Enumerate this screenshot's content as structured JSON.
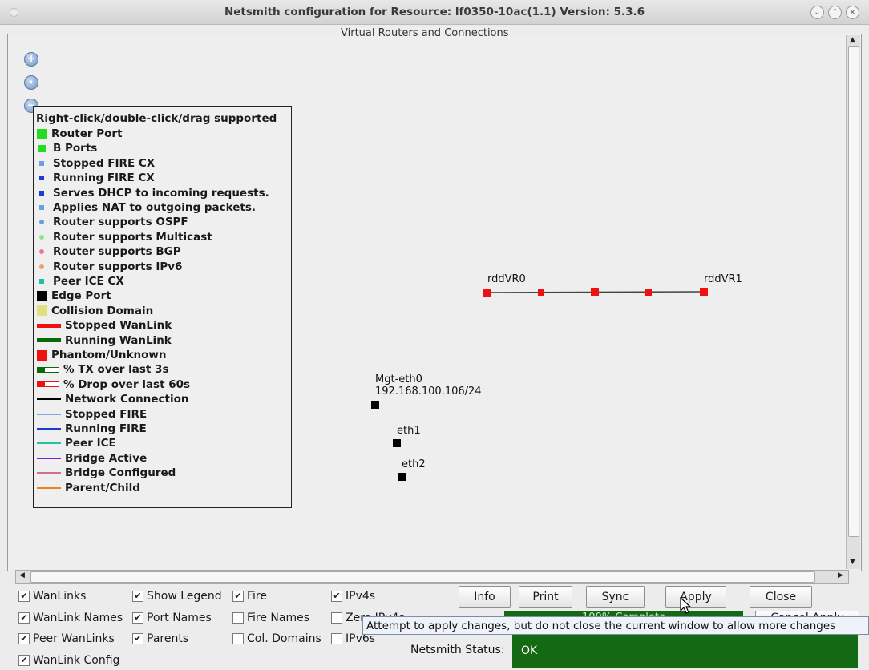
{
  "window": {
    "title": "Netsmith configuration for Resource:  lf0350-10ac(1.1)  Version: 5.3.6",
    "buttons": {
      "minimize": "⌄",
      "maximize": "⌃",
      "close": "×"
    }
  },
  "panel": {
    "title": "Virtual Routers and Connections",
    "zoom_icons": [
      "zoom-in-icon",
      "zoom-reset-icon",
      "zoom-out-icon"
    ]
  },
  "legend": {
    "header": "Right-click/double-click/drag supported",
    "items": [
      {
        "label": "Router Port",
        "kind": "square",
        "color": "#22dd22"
      },
      {
        "label": "B Ports",
        "kind": "square-sm",
        "color": "#22dd22"
      },
      {
        "label": "Stopped FIRE CX",
        "kind": "square-xs",
        "color": "#6d9ce8"
      },
      {
        "label": "Running FIRE CX",
        "kind": "square-xs",
        "color": "#1a3fd0"
      },
      {
        "label": "Serves DHCP to incoming requests.",
        "kind": "square-xs",
        "color": "#1a3fd0"
      },
      {
        "label": "Applies NAT to outgoing packets.",
        "kind": "square-xs",
        "color": "#6d9ce8"
      },
      {
        "label": "Router supports OSPF",
        "kind": "dot",
        "color": "#6d9ce8"
      },
      {
        "label": "Router supports Multicast",
        "kind": "dot",
        "color": "#88e888"
      },
      {
        "label": "Router supports BGP",
        "kind": "dot",
        "color": "#f07090"
      },
      {
        "label": "Router supports IPv6",
        "kind": "dot",
        "color": "#f59a60"
      },
      {
        "label": "Peer ICE CX",
        "kind": "square-xs",
        "color": "#1fbfa0"
      },
      {
        "label": "Edge Port",
        "kind": "square",
        "color": "#000000"
      },
      {
        "label": "Collision Domain",
        "kind": "square",
        "color": "#e0e080"
      },
      {
        "label": "Stopped WanLink",
        "kind": "bar-thick",
        "color": "#ee1111"
      },
      {
        "label": "Running WanLink",
        "kind": "bar-thick",
        "color": "#0a6a0a"
      },
      {
        "label": "Phantom/Unknown",
        "kind": "square",
        "color": "#ee1111"
      },
      {
        "label": "% TX over last 3s",
        "kind": "bar-outline",
        "color": "#0a6a0a"
      },
      {
        "label": "% Drop over last 60s",
        "kind": "bar-outline",
        "color": "#ee1111"
      },
      {
        "label": "Network Connection",
        "kind": "line",
        "color": "#000000"
      },
      {
        "label": "Stopped FIRE",
        "kind": "line",
        "color": "#7da8e8"
      },
      {
        "label": "Running FIRE",
        "kind": "line",
        "color": "#1a3fd0"
      },
      {
        "label": "Peer ICE",
        "kind": "line",
        "color": "#20c0a0"
      },
      {
        "label": "Bridge Active",
        "kind": "line",
        "color": "#8020e0"
      },
      {
        "label": "Bridge Configured",
        "kind": "line",
        "color": "#d07090"
      },
      {
        "label": "Parent/Child",
        "kind": "line",
        "color": "#f08020"
      }
    ]
  },
  "topology": {
    "routers": [
      {
        "name": "rddVR0",
        "color": "#ee1111"
      },
      {
        "name": "rddVR1",
        "color": "#ee1111"
      }
    ],
    "link_ports_color": "#ee1111",
    "ports": [
      {
        "name": "Mgt-eth0",
        "ip": "192.168.100.106/24"
      },
      {
        "name": "eth1",
        "ip": ""
      },
      {
        "name": "eth2",
        "ip": ""
      }
    ]
  },
  "options": {
    "col1": [
      {
        "label": "WanLinks",
        "checked": true
      },
      {
        "label": "WanLink Names",
        "checked": true
      },
      {
        "label": "Peer WanLinks",
        "checked": true
      },
      {
        "label": "WanLink Config",
        "checked": true
      }
    ],
    "col2": [
      {
        "label": "Show Legend",
        "checked": true
      },
      {
        "label": "Port Names",
        "checked": true
      },
      {
        "label": "Parents",
        "checked": true
      }
    ],
    "col3": [
      {
        "label": "Fire",
        "checked": true
      },
      {
        "label": "Fire Names",
        "checked": false
      },
      {
        "label": "Col. Domains",
        "checked": false
      }
    ],
    "col4": [
      {
        "label": "IPv4s",
        "checked": true
      },
      {
        "label": "Zero IPv4s",
        "checked": false
      },
      {
        "label": "IPv6s",
        "checked": false
      }
    ]
  },
  "buttons": {
    "info": "Info",
    "print": "Print",
    "sync": "Sync",
    "apply": "Apply",
    "close": "Close",
    "cancel": "Cancel Apply"
  },
  "progress": {
    "text": "100% Complete",
    "value": 1.0
  },
  "status": {
    "label": "Netsmith Status:",
    "value": "OK"
  },
  "tooltip": "Attempt to apply changes, but do not close the current window to allow more changes"
}
